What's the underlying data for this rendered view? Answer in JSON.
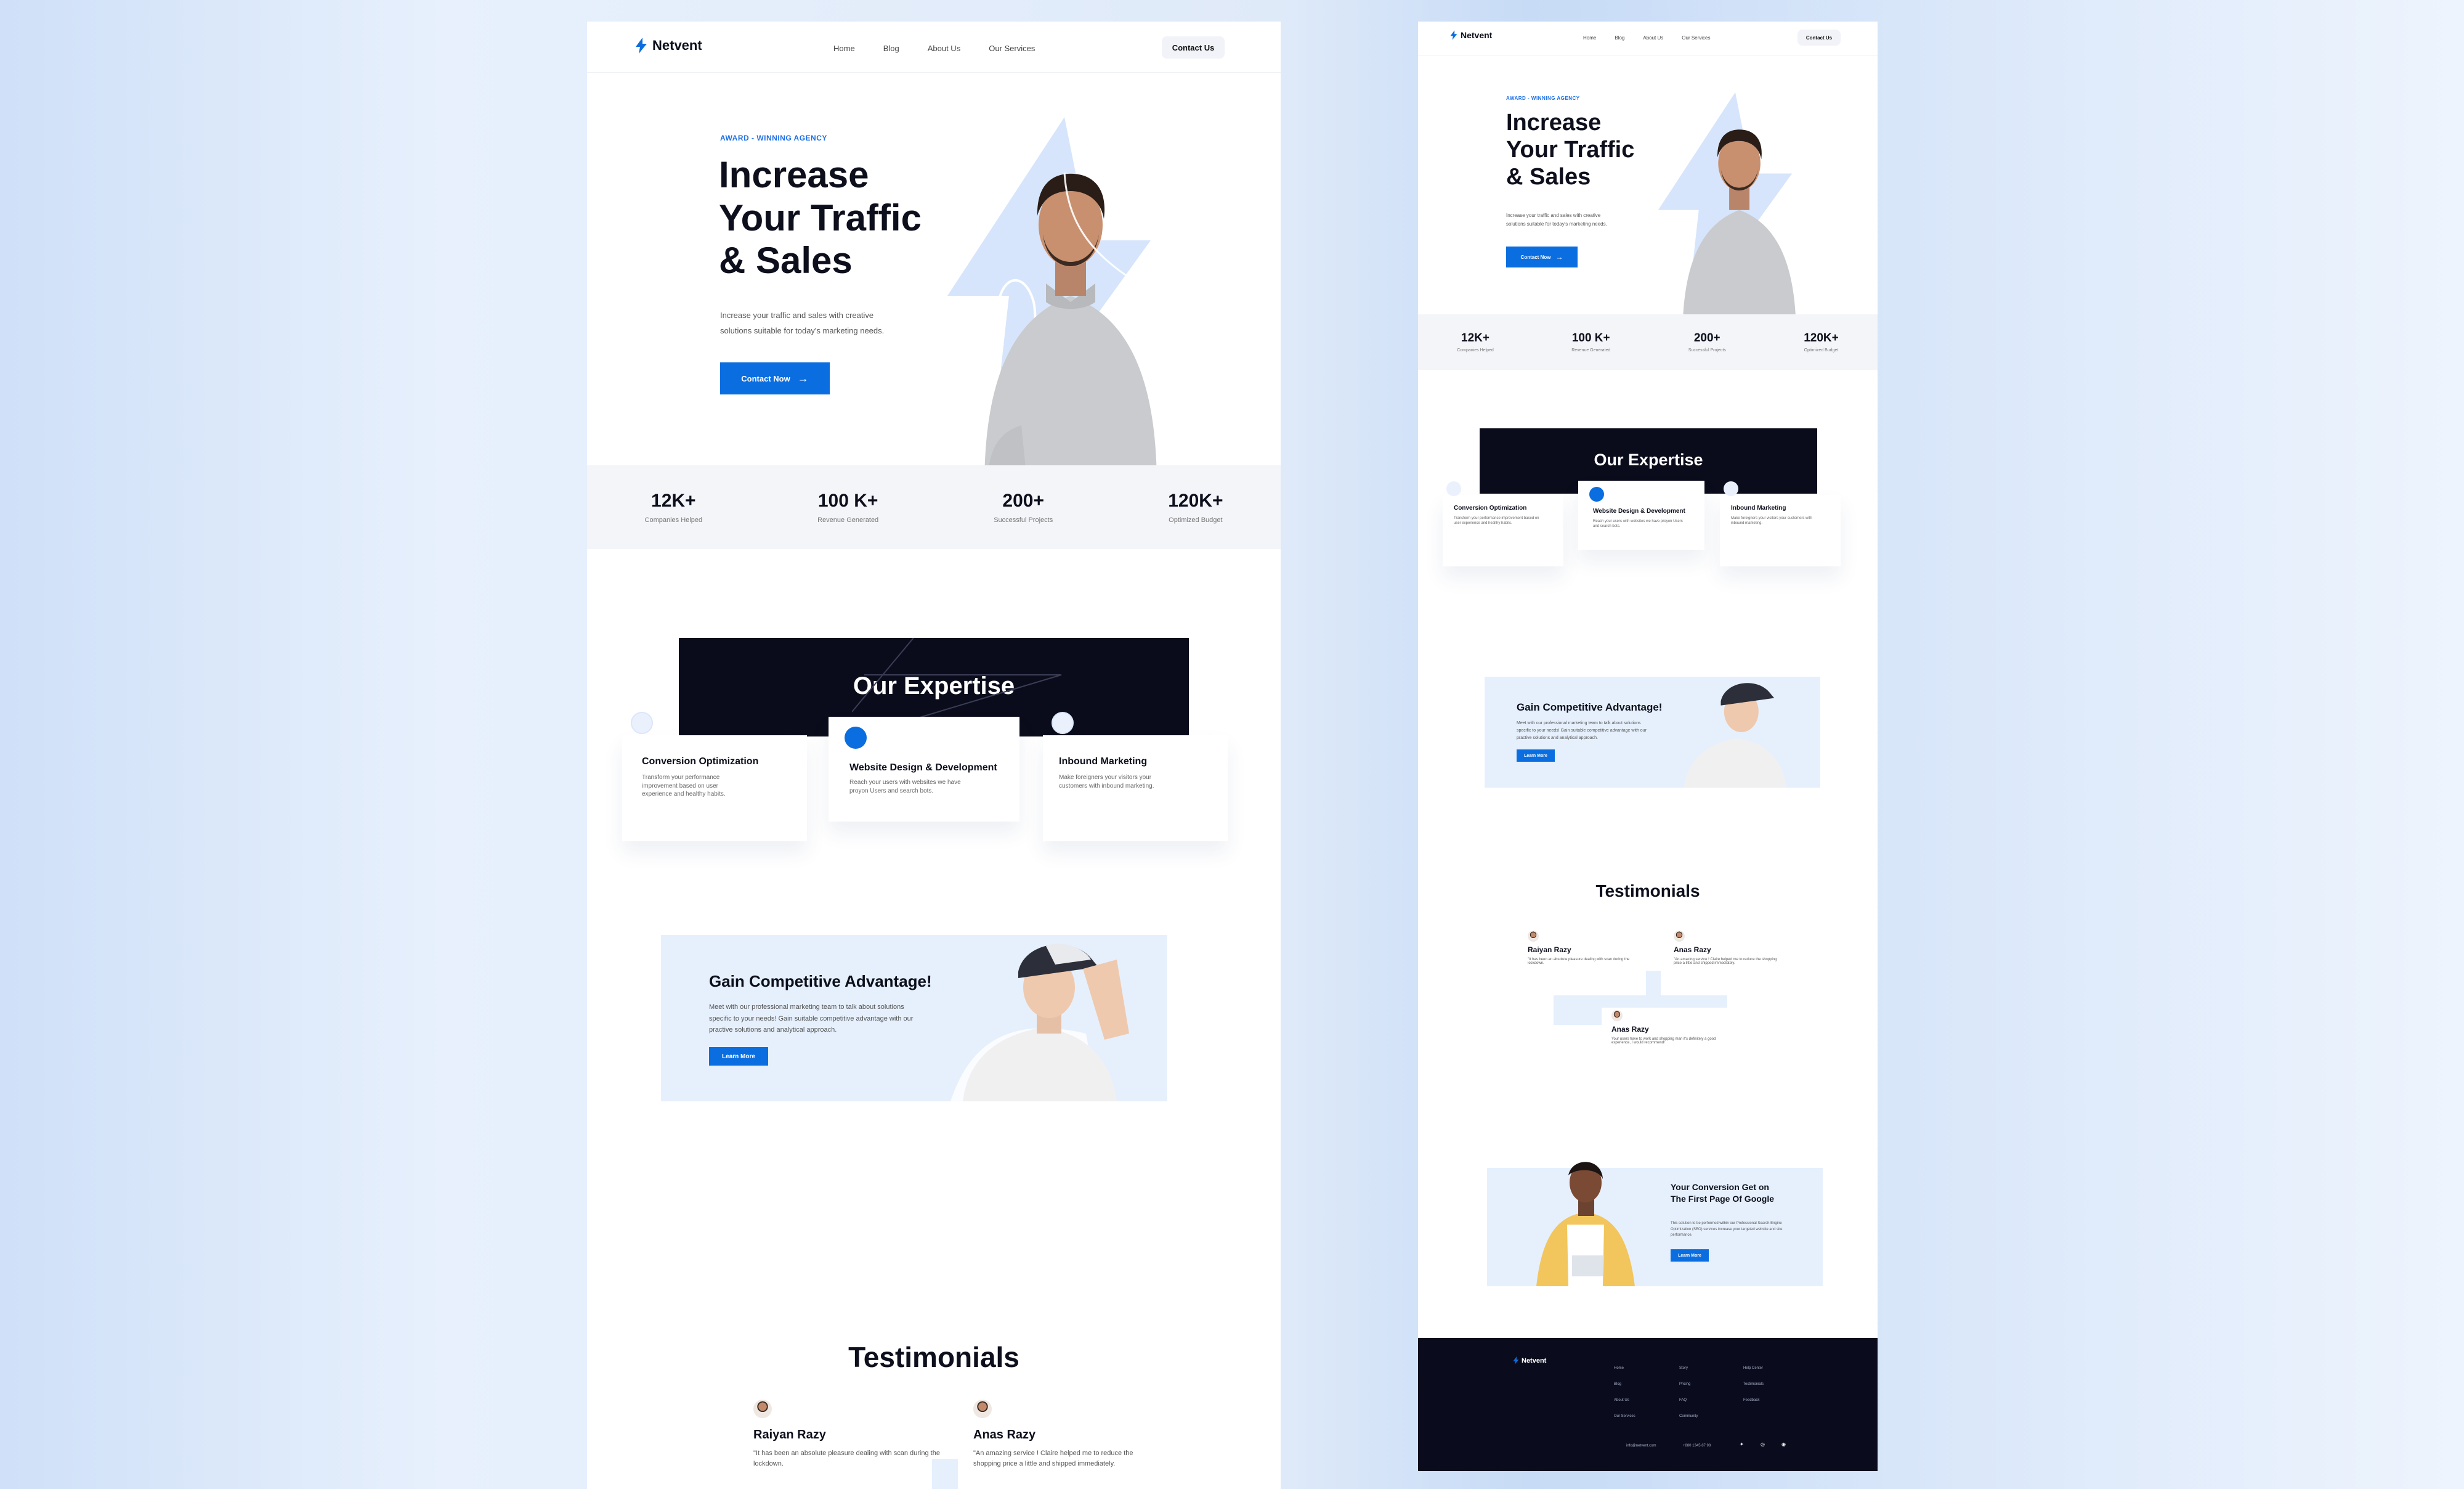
{
  "brand": {
    "name": "Netvent",
    "accent": "#0a6ee0",
    "dark": "#0b0c1b",
    "light": "#e6f0fd"
  },
  "nav": {
    "items": [
      "Home",
      "Blog",
      "About Us",
      "Our Services"
    ],
    "contact": "Contact Us"
  },
  "hero": {
    "eyebrow": "AWARD - WINNING AGENCY",
    "title_lines": [
      "Increase",
      "Your Traffic",
      "& Sales"
    ],
    "desc_lines": [
      "Increase your traffic and sales with creative",
      "solutions  suitable for today's marketing needs."
    ],
    "button": "Contact Now"
  },
  "stats": [
    {
      "value": "12K+",
      "label": "Companies Helped"
    },
    {
      "value": "100 K+",
      "label": "Revenue Generated"
    },
    {
      "value": "200+",
      "label": "Successful Projects"
    },
    {
      "value": "120K+",
      "label": "Optimized Budget"
    }
  ],
  "expertise": {
    "title": "Our Expertise",
    "cards": [
      {
        "title": "Conversion Optimization",
        "desc": "Transform your performance improvement based on user experience and healthy habits."
      },
      {
        "title": "Website Design & Development",
        "desc": "Reach your users with websites we have proyon Users and search bots."
      },
      {
        "title": "Inbound Marketing",
        "desc": "Make foreigners your visitors your customers with inbound marketing."
      }
    ]
  },
  "advantage": {
    "title": "Gain Competitive Advantage!",
    "desc_lines": [
      "Meet with our professional marketing team to talk about solutions",
      "specific to your needs! Gain suitable competitive advantage with our",
      "practive solutions and analytical approach."
    ],
    "button": "Learn More"
  },
  "testimonials": {
    "title": "Testimonials",
    "items": [
      {
        "name": "Raiyan  Razy",
        "text": "\"It has been an absolute pleasure dealing with scan during the lockdown."
      },
      {
        "name": "Anas Razy",
        "text": "\"An amazing service ! Claire helped me to reduce the shopping price a little and shipped immediately."
      },
      {
        "name": "Anas Razy",
        "text": "Your users have to work and shopping man it's definitely a good experience, I would recommend!"
      }
    ]
  },
  "google": {
    "title_lines": [
      "Your Conversion Get on",
      "The First Page Of Google"
    ],
    "desc": "This solution to be performed within our Professional Search Engine Optimization (SEO) services increase your targeted website and site performance.",
    "button": "Learn More"
  },
  "footer": {
    "cols": [
      [
        "Home",
        "Blog",
        "About Us",
        "Our Services"
      ],
      [
        "Story",
        "Pricing",
        "FAQ",
        "Community"
      ],
      [
        "Help Center",
        "Testimonials",
        "Feedback"
      ]
    ],
    "email": "info@netvent.com",
    "phone": "+880 1345 87 98"
  }
}
